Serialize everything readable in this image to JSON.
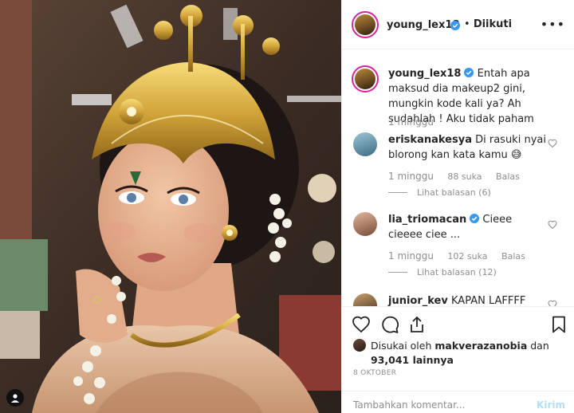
{
  "header": {
    "username": "young_lex18",
    "separator": "•",
    "follow_status": "Diikuti"
  },
  "caption": {
    "username": "young_lex18",
    "text": "Entah apa maksud dia makeup2 gini, mungkin kode kali ya? Ah sudahlah ! Aku tidak paham",
    "time": "1 minggu"
  },
  "comments": [
    {
      "username": "eriskanakesya",
      "text": "Di rasuki nyai blorong kan kata kamu",
      "emoji": "😅",
      "time": "1 minggu",
      "likes": "88 suka",
      "reply": "Balas",
      "view_replies": "Lihat balasan (6)"
    },
    {
      "username": "lia_triomacan",
      "text": "Cieee cieeee ciee ...",
      "time": "1 minggu",
      "likes": "102 suka",
      "reply": "Balas",
      "view_replies": "Lihat balasan (12)"
    },
    {
      "username": "junior_kev",
      "text": "KAPAN LAFFFF"
    }
  ],
  "likes": {
    "prefix": "Disukai oleh",
    "liker": "makverazanobia",
    "conjunction": "dan",
    "others": "93,041 lainnya"
  },
  "date": "8 OKTOBER",
  "add_comment": {
    "placeholder": "Tambahkan komentar...",
    "post_label": "Kirim"
  },
  "icons": {
    "like": "heart-icon",
    "comment": "comment-icon",
    "share": "share-icon",
    "save": "bookmark-icon",
    "verified": "verified-badge-icon",
    "more": "more-options-icon"
  },
  "colors": {
    "verified": "#3897f0",
    "post_disabled": "#b2dffc",
    "ring": "#d6249f"
  }
}
